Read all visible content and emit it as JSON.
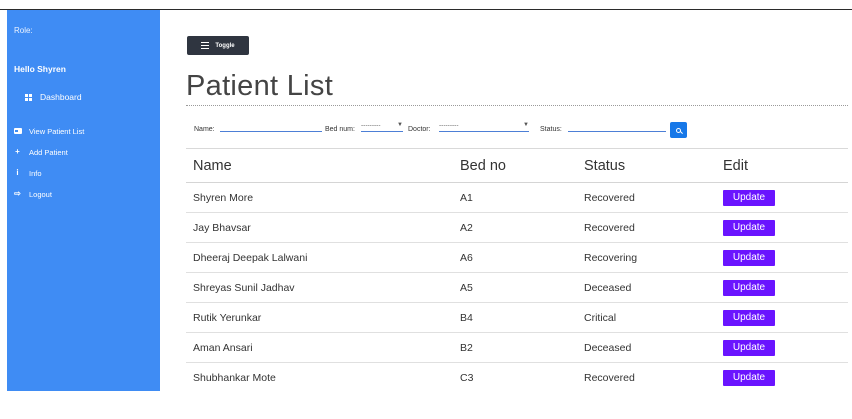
{
  "sidebar": {
    "role_label": "Role:",
    "greeting": "Hello Shyren",
    "dashboard": {
      "label": "Dashboard",
      "icon": "dashboard-icon"
    },
    "items": [
      {
        "label": "View Patient List",
        "icon": "id-card-icon"
      },
      {
        "label": "Add Patient",
        "icon": "plus-icon"
      },
      {
        "label": "Info",
        "icon": "info-icon"
      },
      {
        "label": "Logout",
        "icon": "sign-out-icon"
      }
    ],
    "background_color": "#3f8cf4"
  },
  "toolbar": {
    "toggle_label": "Toggle",
    "toggle_icon": "bars-icon"
  },
  "main": {
    "title": "Patient List"
  },
  "filters": {
    "name_label": "Name:",
    "name_value": "",
    "bed_label": "Bed num:",
    "bed_value": "---------",
    "doctor_label": "Doctor:",
    "doctor_value": "---------",
    "status_label": "Status:",
    "status_value": "",
    "search_icon": "search-icon"
  },
  "table": {
    "headers": [
      "Name",
      "Bed no",
      "Status",
      "Edit"
    ],
    "action_label": "Update",
    "action_color": "#6a14ff",
    "rows": [
      {
        "name": "Shyren More",
        "bed": "A1",
        "status": "Recovered"
      },
      {
        "name": "Jay Bhavsar",
        "bed": "A2",
        "status": "Recovered"
      },
      {
        "name": "Dheeraj Deepak Lalwani",
        "bed": "A6",
        "status": "Recovering"
      },
      {
        "name": "Shreyas Sunil Jadhav",
        "bed": "A5",
        "status": "Deceased"
      },
      {
        "name": "Rutik Yerunkar",
        "bed": "B4",
        "status": "Critical"
      },
      {
        "name": "Aman Ansari",
        "bed": "B2",
        "status": "Deceased"
      },
      {
        "name": "Shubhankar Mote",
        "bed": "C3",
        "status": "Recovered"
      }
    ]
  }
}
